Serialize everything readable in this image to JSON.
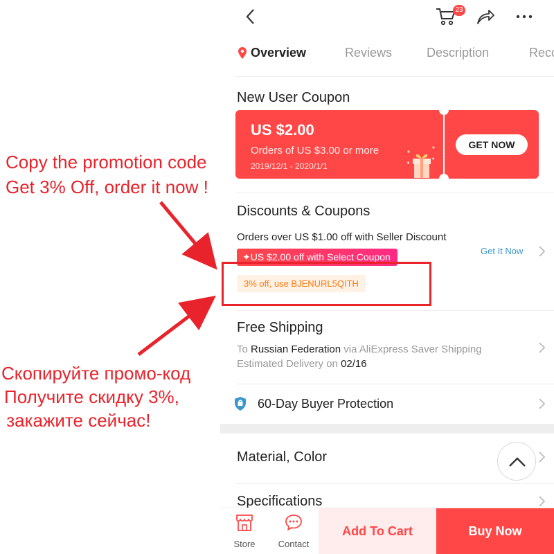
{
  "annotations": {
    "english": [
      "Copy the promotion code",
      "Get 3% Off, order it now !"
    ],
    "russian": [
      "Скопируйте промо-код",
      "Получите скидку 3%,",
      " закажите сейчас!"
    ]
  },
  "header": {
    "cart_badge": "23",
    "icons": [
      "back-icon",
      "cart-icon",
      "share-icon",
      "more-icon"
    ]
  },
  "tabs": [
    {
      "label": "Overview",
      "active": true
    },
    {
      "label": "Reviews",
      "active": false
    },
    {
      "label": "Description",
      "active": false
    },
    {
      "label": "Reco",
      "active": false
    }
  ],
  "new_user_coupon": {
    "title": "New User Coupon",
    "amount": "US $2.00",
    "condition": "Orders of US $3.00 or more",
    "validity": "2019/12/1 - 2020/1/1",
    "button": "GET NOW"
  },
  "discounts": {
    "title": "Discounts & Coupons",
    "seller_discount": "Orders over US $1.00 off with Seller Discount",
    "select_coupon": "✦US $2.00 off with Select Coupon",
    "get_it_now": "Get It Now",
    "promo_code": "3% off, use BJENURL5QITH"
  },
  "shipping": {
    "title": "Free Shipping",
    "to_label": "To",
    "destination": "Russian Federation",
    "via_label": "via AliExpress Saver Shipping",
    "estimated_label": "Estimated Delivery on",
    "date": "02/16"
  },
  "protection": {
    "label": "60-Day Buyer Protection"
  },
  "material_color": {
    "title": "Material, Color"
  },
  "specifications": {
    "title": "Specifications"
  },
  "bottom_bar": {
    "store": "Store",
    "contact": "Contact",
    "add_to_cart": "Add To Cart",
    "buy_now": "Buy Now"
  },
  "colors": {
    "accent": "#ff4747",
    "annotation": "#e8232b",
    "promo_text": "#ff7a12",
    "link": "#3a97c9"
  }
}
